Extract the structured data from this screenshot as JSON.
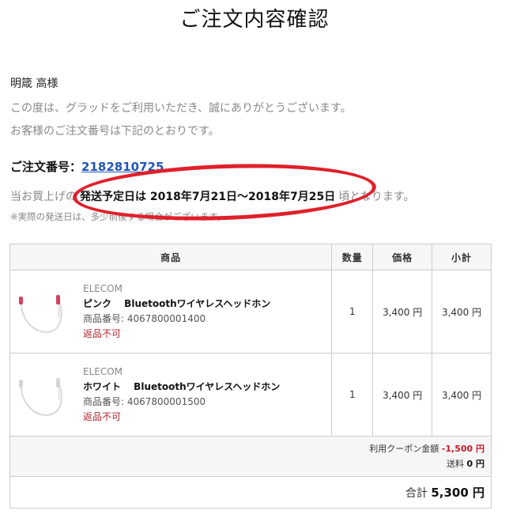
{
  "title": "ご注文内容確認",
  "greeting": {
    "customer": "明箴 高様",
    "line1": "この度は、グラッドをご利用いただき、誠にありがとうございます。",
    "line2": "お客様のご注文番号は下記のとおりです。"
  },
  "order": {
    "label": "ご注文番号：",
    "number": "2182810725"
  },
  "shipping": {
    "prefix": "当お買上げの",
    "highlight": "発送予定日は 2018年7月21日〜2018年7月25日",
    "suffix": "頃となります。",
    "note": "※実際の発送日は、多少前後する場合がございます。"
  },
  "table": {
    "headers": {
      "product": "商品",
      "qty": "数量",
      "price": "価格",
      "subtotal": "小計"
    },
    "items": [
      {
        "brand": "ELECOM",
        "name": "ピンク　 Bluetoothワイヤレスヘッドホン",
        "code": "商品番号: 4067800001400",
        "note": "返品不可",
        "qty": "1",
        "price": "3,400 円",
        "subtotal": "3,400 円",
        "accent_color": "#d2425c"
      },
      {
        "brand": "ELECOM",
        "name": "ホワイト　 Bluetoothワイヤレスヘッドホン",
        "code": "商品番号: 4067800001500",
        "note": "返品不可",
        "qty": "1",
        "price": "3,400 円",
        "subtotal": "3,400 円",
        "accent_color": "#cccccc"
      }
    ],
    "summary": {
      "coupon_label": "利用クーポン金額",
      "coupon_value": "-1,500 円",
      "shipping_label": "送料",
      "shipping_value": "0 円"
    },
    "total": {
      "label": "合計",
      "value": "5,300 円"
    }
  },
  "colors": {
    "highlight_circle": "#e0202a",
    "link": "#2155b8",
    "discount": "#c81a2a"
  }
}
